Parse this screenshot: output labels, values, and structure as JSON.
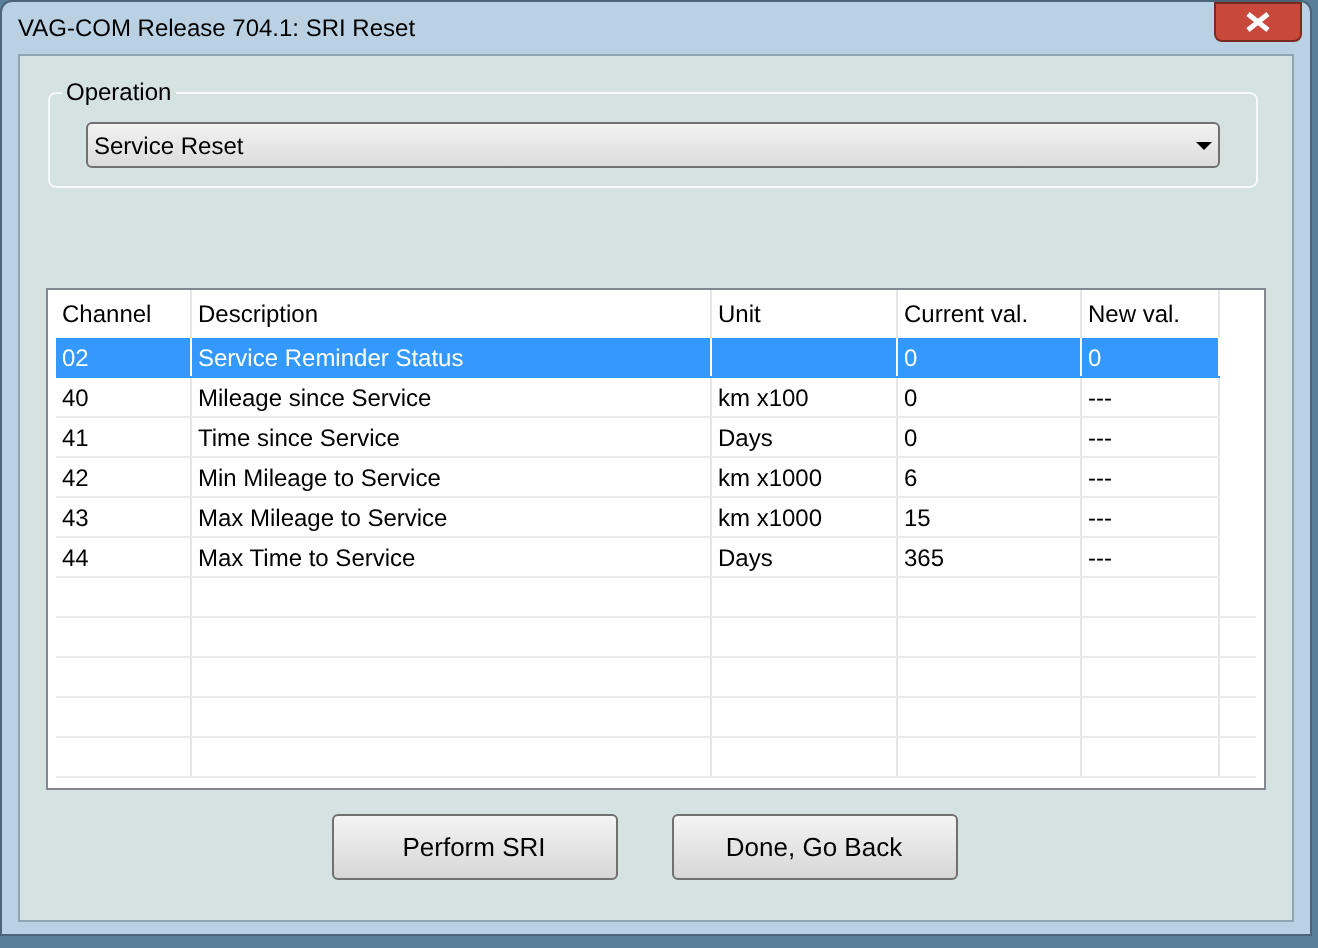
{
  "window": {
    "title": "VAG-COM Release 704.1:  SRI Reset"
  },
  "operation": {
    "label": "Operation",
    "value": "Service Reset"
  },
  "table": {
    "columns": [
      "Channel",
      "Description",
      "Unit",
      "Current val.",
      "New val."
    ],
    "rows": [
      {
        "cells": [
          "02",
          "Service Reminder Status",
          "",
          "0",
          "0"
        ],
        "selected": true
      },
      {
        "cells": [
          "40",
          "Mileage since Service",
          "km x100",
          "0",
          "---"
        ],
        "selected": false
      },
      {
        "cells": [
          "41",
          "Time since Service",
          "Days",
          "0",
          "---"
        ],
        "selected": false
      },
      {
        "cells": [
          "42",
          "Min Mileage to Service",
          "km x1000",
          "6",
          "---"
        ],
        "selected": false
      },
      {
        "cells": [
          "43",
          "Max Mileage to Service",
          "km x1000",
          "15",
          "---"
        ],
        "selected": false
      },
      {
        "cells": [
          "44",
          "Max Time to Service",
          "Days",
          "365",
          "---"
        ],
        "selected": false
      }
    ]
  },
  "buttons": [
    "Perform SRI",
    "Done, Go Back"
  ]
}
